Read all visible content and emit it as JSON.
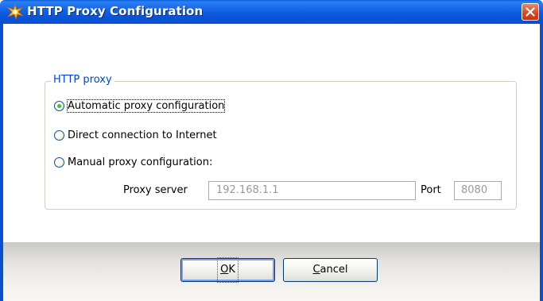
{
  "window": {
    "title": "HTTP Proxy Configuration",
    "icon": "sparkle-app-icon",
    "close_icon": "close-icon"
  },
  "group": {
    "legend": "HTTP proxy",
    "options": [
      {
        "label": "Automatic proxy configuration",
        "checked": true
      },
      {
        "label": "Direct connection to Internet",
        "checked": false
      },
      {
        "label": "Manual proxy configuration:",
        "checked": false
      }
    ]
  },
  "proxy": {
    "server_label": "Proxy server",
    "server_value": "192.168.1.1",
    "port_label": "Port",
    "port_value": "8080"
  },
  "buttons": {
    "ok_mnemonic": "O",
    "ok_rest": "K",
    "cancel_mnemonic": "C",
    "cancel_rest": "ancel"
  },
  "colors": {
    "titlebar": "#0a54d8",
    "legend_text": "#0046d5",
    "close_button": "#d6481f"
  }
}
